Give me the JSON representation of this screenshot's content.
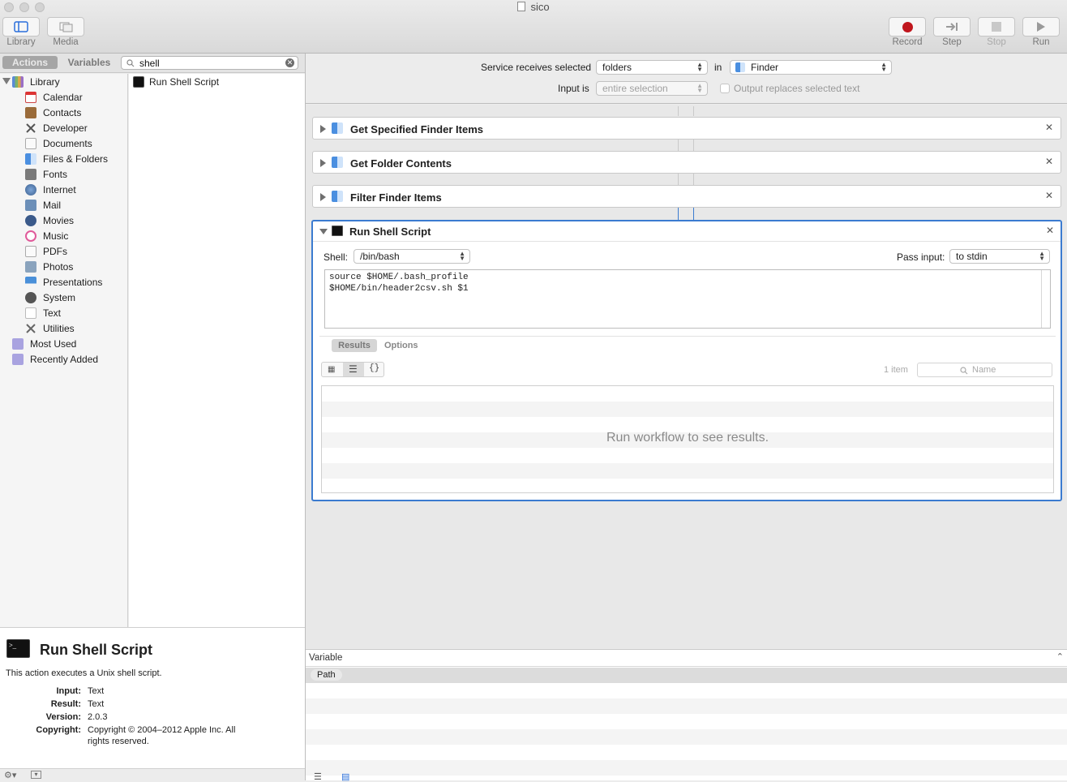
{
  "window": {
    "title": "sico"
  },
  "toolbar": {
    "library_label": "Library",
    "media_label": "Media",
    "record_label": "Record",
    "step_label": "Step",
    "stop_label": "Stop",
    "run_label": "Run"
  },
  "left": {
    "tab_actions": "Actions",
    "tab_variables": "Variables",
    "search_value": "shell",
    "library_root": "Library",
    "categories": [
      "Calendar",
      "Contacts",
      "Developer",
      "Documents",
      "Files & Folders",
      "Fonts",
      "Internet",
      "Mail",
      "Movies",
      "Music",
      "PDFs",
      "Photos",
      "Presentations",
      "System",
      "Text",
      "Utilities"
    ],
    "smart_groups": [
      "Most Used",
      "Recently Added"
    ],
    "results": [
      "Run Shell Script"
    ]
  },
  "description": {
    "title": "Run Shell Script",
    "summary": "This action executes a Unix shell script.",
    "input_key": "Input:",
    "input_val": "Text",
    "result_key": "Result:",
    "result_val": "Text",
    "version_key": "Version:",
    "version_val": "2.0.3",
    "copyright_key": "Copyright:",
    "copyright_line1": "Copyright © 2004–2012 Apple Inc.  All",
    "copyright_line2": "rights reserved."
  },
  "service": {
    "receives_label": "Service receives selected",
    "receives_value": "folders",
    "in_label": "in",
    "in_value": "Finder",
    "input_is_label": "Input is",
    "input_is_value": "entire selection",
    "output_replaces_label": "Output replaces selected text",
    "output_replaces_checked": false
  },
  "actions": [
    {
      "title": "Get Specified Finder Items"
    },
    {
      "title": "Get Folder Contents"
    },
    {
      "title": "Filter Finder Items"
    }
  ],
  "shell_action": {
    "title": "Run Shell Script",
    "shell_label": "Shell:",
    "shell_value": "/bin/bash",
    "pass_input_label": "Pass input:",
    "pass_input_value": "to stdin",
    "script_line1": "source $HOME/.bash_profile",
    "script_line2": "$HOME/bin/header2csv.sh $1",
    "tab_results": "Results",
    "tab_options": "Options",
    "item_count": "1 item",
    "filter_placeholder": "Name",
    "empty_message": "Run workflow to see results."
  },
  "variables": {
    "header": "Variable",
    "items": [
      "Path"
    ]
  },
  "colors": {
    "accent": "#3b7bd0",
    "record": "#c0161d"
  }
}
